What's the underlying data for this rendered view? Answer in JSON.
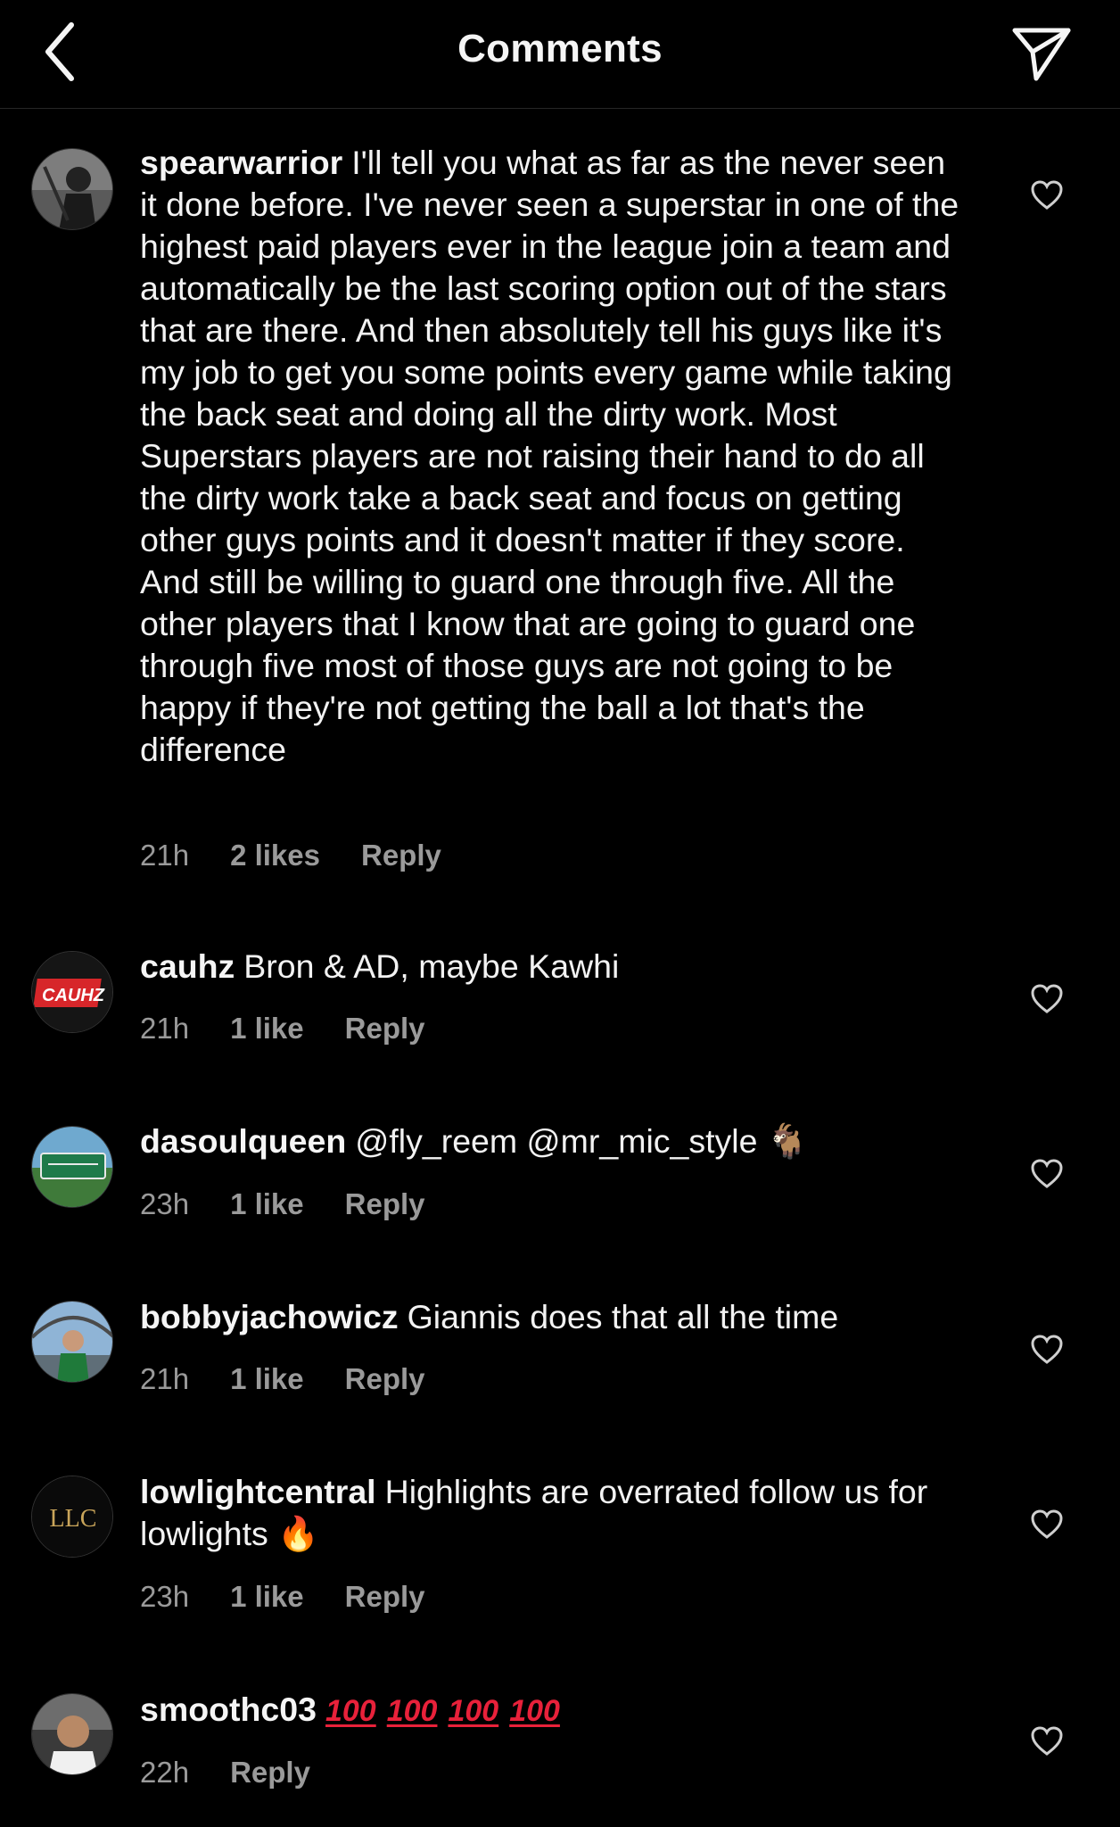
{
  "header": {
    "title": "Comments",
    "back_icon": "chevron-left-icon",
    "share_icon": "send-icon"
  },
  "comments": [
    {
      "username": "spearwarrior",
      "text": "I'll tell you what as far as the never seen it done before. I've never seen a superstar in one of the highest paid players ever in the league join a team and automatically be the last scoring option out of the stars that are there. And then absolutely tell his guys like it's my job to get you some points every game while taking the back seat and doing all the dirty work. Most Superstars players are not raising their hand to do all the dirty work take a back seat and focus on getting other guys points and it doesn't matter if they score. And still be willing to guard one through five. All the other players that I know that are going to guard one through five most of those guys are not going to be happy if they're not getting the ball a lot that's the difference",
      "time": "21h",
      "likes": "2 likes",
      "reply": "Reply"
    },
    {
      "username": "cauhz",
      "text": "Bron & AD, maybe Kawhi",
      "avatar_label": "CAUHZ",
      "time": "21h",
      "likes": "1 like",
      "reply": "Reply"
    },
    {
      "username": "dasoulqueen",
      "text": "@fly_reem @mr_mic_style",
      "emoji": "🐐",
      "time": "23h",
      "likes": "1 like",
      "reply": "Reply"
    },
    {
      "username": "bobbyjachowicz",
      "text": "Giannis does that all the time",
      "time": "21h",
      "likes": "1 like",
      "reply": "Reply"
    },
    {
      "username": "lowlightcentral",
      "text": "Highlights are overrated follow us for lowlights",
      "emoji": "🔥",
      "avatar_label": "LLC",
      "time": "23h",
      "likes": "1 like",
      "reply": "Reply"
    },
    {
      "username": "smoothc03",
      "emoji_items": [
        "100",
        "100",
        "100",
        "100"
      ],
      "time": "22h",
      "reply": "Reply"
    }
  ],
  "colors": {
    "background": "#000000",
    "text": "#f5f5f5",
    "meta": "#9a9a9a",
    "hundred_red": "#e8213a"
  }
}
